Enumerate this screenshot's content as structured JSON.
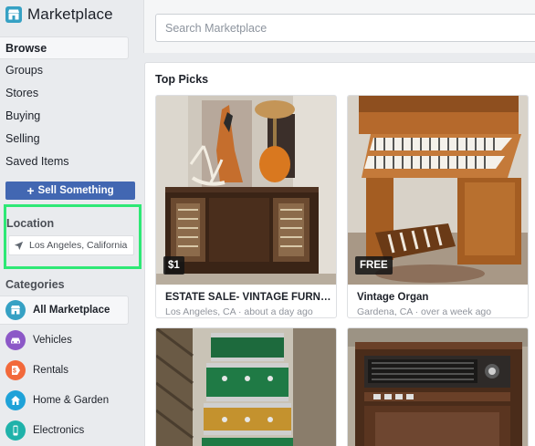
{
  "app": {
    "title": "Marketplace",
    "brand_icon": "marketplace-storefront-icon",
    "accent_color": "#4267b2"
  },
  "sidebar": {
    "nav": [
      {
        "label": "Browse",
        "active": true
      },
      {
        "label": "Groups",
        "active": false
      },
      {
        "label": "Stores",
        "active": false
      },
      {
        "label": "Buying",
        "active": false
      },
      {
        "label": "Selling",
        "active": false
      },
      {
        "label": "Saved Items",
        "active": false
      }
    ],
    "sell_button": "Sell Something",
    "location": {
      "heading": "Location",
      "value": "Los Angeles, California",
      "icon": "navigation-arrow-icon",
      "highlight_color": "#2ee875"
    },
    "categories": {
      "heading": "Categories",
      "items": [
        {
          "label": "All Marketplace",
          "icon": "storefront-icon",
          "color": "#36a1c4",
          "active": true
        },
        {
          "label": "Vehicles",
          "icon": "car-icon",
          "color": "#8c58c7",
          "active": false
        },
        {
          "label": "Rentals",
          "icon": "price-tag-icon",
          "color": "#f2693b",
          "active": false
        },
        {
          "label": "Home & Garden",
          "icon": "house-icon",
          "color": "#1fa2d8",
          "active": false
        },
        {
          "label": "Electronics",
          "icon": "phone-icon",
          "color": "#1fb2aa",
          "active": false
        }
      ]
    }
  },
  "search": {
    "placeholder": "Search Marketplace"
  },
  "main": {
    "section_title": "Top Picks",
    "listings": [
      {
        "price": "$1",
        "title": "ESTATE SALE- VINTAGE FURNIT...",
        "meta": "Los Angeles, CA · about a day ago"
      },
      {
        "price": "FREE",
        "title": "Vintage Organ",
        "meta": "Gardena, CA · over a week ago"
      },
      {
        "price": "",
        "title": "",
        "meta": ""
      },
      {
        "price": "",
        "title": "",
        "meta": ""
      }
    ]
  }
}
